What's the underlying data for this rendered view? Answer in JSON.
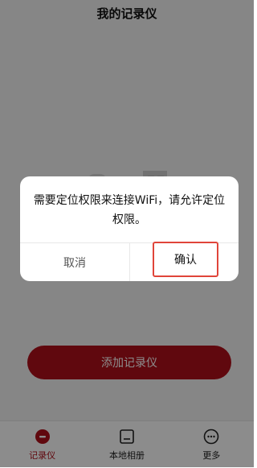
{
  "header": {
    "title": "我的记录仪"
  },
  "main": {
    "add_button_label": "添加记录仪"
  },
  "tabbar": {
    "items": [
      {
        "label": "记录仪",
        "icon": "recorder-icon",
        "active": true
      },
      {
        "label": "本地相册",
        "icon": "album-icon",
        "active": false
      },
      {
        "label": "更多",
        "icon": "more-icon",
        "active": false
      }
    ]
  },
  "dialog": {
    "message": "需要定位权限来连接WiFi，请允许定位权限。",
    "cancel_label": "取消",
    "confirm_label": "确认"
  },
  "colors": {
    "accent": "#b0101a",
    "highlight_border": "#e0453a"
  }
}
